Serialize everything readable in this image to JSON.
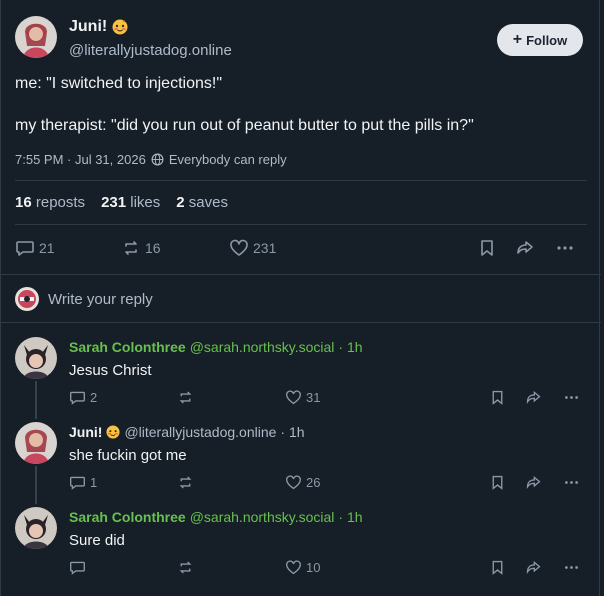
{
  "post": {
    "author_name": "Juni!",
    "author_handle": "@literallyjustadog.online",
    "follow_label": "Follow",
    "text_line1": "me: \"I switched to injections!\"",
    "text_line2": "my therapist: \"did you run out of peanut butter to put the pills in?\"",
    "timestamp": "7:55 PM · Jul 31, 2026",
    "reply_setting": "Everybody can reply",
    "stats": {
      "reposts_count": "16",
      "reposts_label": "reposts",
      "likes_count": "231",
      "likes_label": "likes",
      "saves_count": "2",
      "saves_label": "saves"
    },
    "actions": {
      "replies": "21",
      "reposts": "16",
      "likes": "231"
    }
  },
  "reply_prompt": "Write your reply",
  "replies": [
    {
      "name": "Sarah Colonthree",
      "handle": "@sarah.northsky.social",
      "time": "· 1h",
      "text": "Jesus Christ",
      "replies": "2",
      "reposts": "",
      "likes": "31"
    },
    {
      "name": "Juni!",
      "handle": "@literallyjustadog.online",
      "time": "· 1h",
      "text": "she fuckin got me",
      "replies": "1",
      "reposts": "",
      "likes": "26"
    },
    {
      "name": "Sarah Colonthree",
      "handle": "@sarah.northsky.social",
      "time": "· 1h",
      "text": "Sure did",
      "replies": "",
      "reposts": "",
      "likes": "10"
    }
  ],
  "colors": {
    "background": "#161e27",
    "accent_green": "#68c04e",
    "text_muted": "#aebbc9",
    "icon_muted": "#8b98a7"
  },
  "icons": [
    "reply-icon",
    "repost-icon",
    "heart-icon",
    "bookmark-icon",
    "share-icon",
    "more-icon",
    "globe-icon",
    "plus-icon"
  ]
}
